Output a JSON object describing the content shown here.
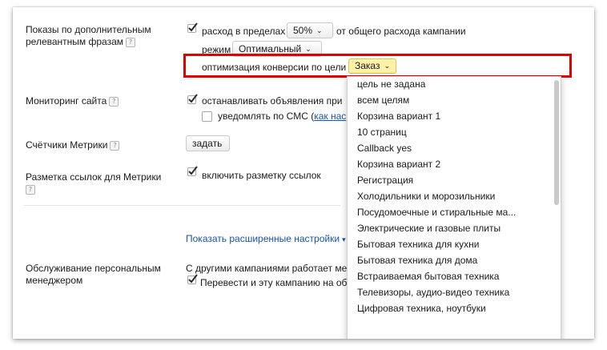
{
  "rows": {
    "impressions_label_1": "Показы по дополнительным",
    "impressions_label_2": "релевантным фразам",
    "spend_prefix": "расход в пределах",
    "spend_percent": "50%",
    "spend_suffix": "от общего расхода кампании",
    "mode_label": "режим",
    "mode_value": "Оптимальный",
    "conversion_label": "оптимизация конверсии по цели",
    "conversion_value": "Заказ",
    "monitoring_label": "Мониторинг сайта",
    "monitoring_stop": "останавливать объявления при",
    "monitoring_sms": "уведомлять по СМС (",
    "monitoring_sms_link": "как нас",
    "counters_label": "Счётчики Метрики",
    "counters_button": "задать",
    "markup_label": "Разметка ссылок для Метрики",
    "markup_check": "включить разметку ссылок",
    "advanced_link": "Показать расширенные настройки",
    "manager_label_1": "Обслуживание персональным",
    "manager_label_2": "менеджером",
    "manager_text": "С другими кампаниями работает мен",
    "manager_check": "Перевести и эту кампанию на обс"
  },
  "help_glyph": "?",
  "dropdown": {
    "items": [
      "цель не задана",
      "всем целям",
      "Корзина вариант 1",
      "10 страниц",
      "Callback yes",
      "Корзина вариант 2",
      "Регистрация",
      "Холодильники и морозильники",
      "Посудомоечные и стиральные ма...",
      "Электрические и газовые плиты",
      "Бытовая техника для кухни",
      "Бытовая техника для дома",
      "Встраиваемая бытовая техника",
      "Телевизоры, аудио-видео техника",
      "Цифровая техника, ноутбуки"
    ]
  },
  "colors": {
    "highlight": "#e00000",
    "selected_bg": "#fff2a8",
    "link": "#1a53a8"
  }
}
